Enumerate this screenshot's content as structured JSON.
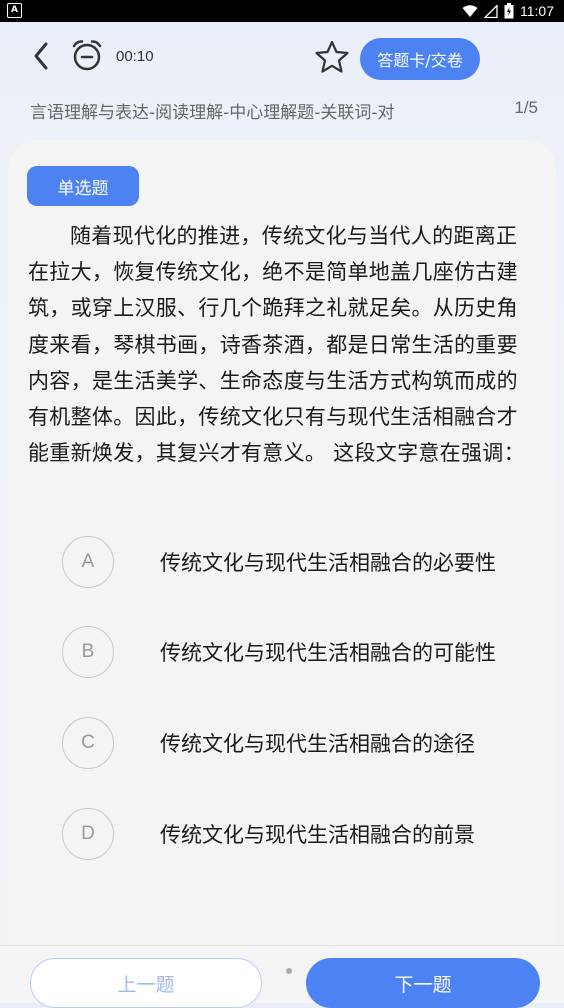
{
  "status_bar": {
    "app_badge": "A",
    "time": "11:07"
  },
  "header": {
    "timer": "00:10",
    "answer_card_button": "答题卡/交卷",
    "category": "言语理解与表达-阅读理解-中心理解题-关联词-对",
    "progress": "1/5"
  },
  "question": {
    "type": "单选题",
    "text": "随着现代化的推进，传统文化与当代人的距离正在拉大，恢复传统文化，绝不是简单地盖几座仿古建筑，或穿上汉服、行几个跪拜之礼就足矣。从历史角度来看，琴棋书画，诗香茶酒，都是日常生活的重要内容，是生活美学、生命态度与生活方式构筑而成的有机整体。因此，传统文化只有与现代生活相融合才能重新焕发，其复兴才有意义。 这段文字意在强调："
  },
  "options": [
    {
      "letter": "A",
      "text": "传统文化与现代生活相融合的必要性"
    },
    {
      "letter": "B",
      "text": "传统文化与现代生活相融合的可能性"
    },
    {
      "letter": "C",
      "text": "传统文化与现代生活相融合的途径"
    },
    {
      "letter": "D",
      "text": "传统文化与现代生活相融合的前景"
    }
  ],
  "footer": {
    "prev_label": "上一题",
    "next_label": "下一题"
  },
  "colors": {
    "accent": "#4d82f3",
    "background": "#f4f4f4"
  }
}
